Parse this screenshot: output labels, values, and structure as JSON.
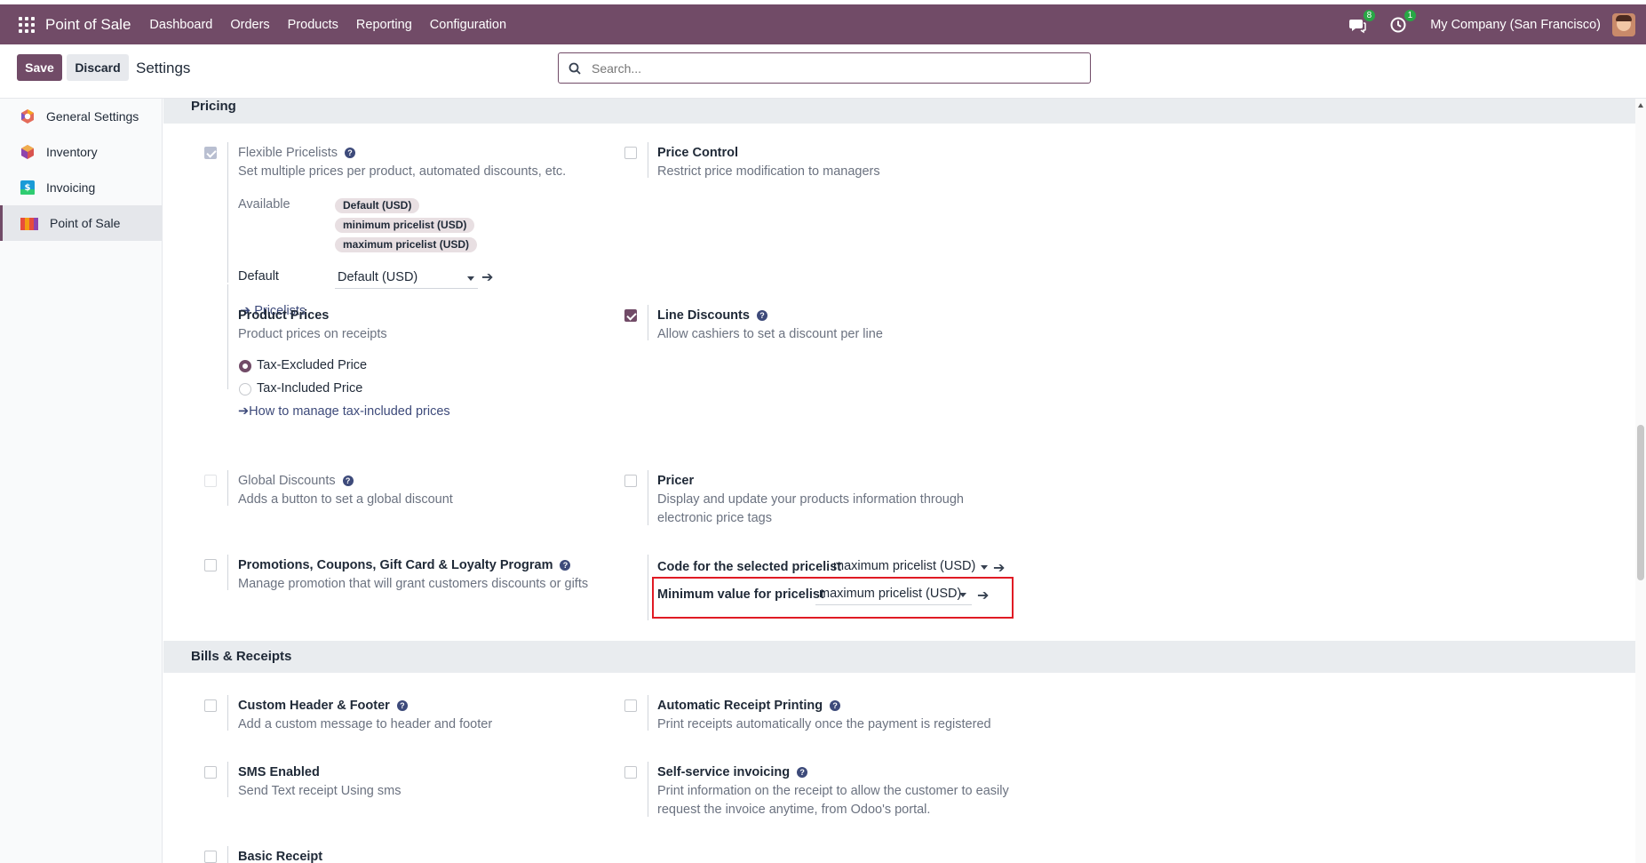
{
  "navbar": {
    "app_name": "Point of Sale",
    "menu": [
      "Dashboard",
      "Orders",
      "Products",
      "Reporting",
      "Configuration"
    ],
    "messages_count": "8",
    "activities_count": "1",
    "company": "My Company (San Francisco)"
  },
  "control_panel": {
    "save_label": "Save",
    "discard_label": "Discard",
    "title": "Settings",
    "search_placeholder": "Search..."
  },
  "sidebar": {
    "items": [
      {
        "label": "General Settings",
        "icon": "odoo-logo-icon"
      },
      {
        "label": "Inventory",
        "icon": "inventory-cube-icon"
      },
      {
        "label": "Invoicing",
        "icon": "invoice-dollar-icon"
      },
      {
        "label": "Point of Sale",
        "icon": "pos-store-icon"
      }
    ],
    "active": "Point of Sale"
  },
  "pricing": {
    "heading": "Pricing",
    "flexible_pricelists": {
      "title": "Flexible Pricelists",
      "desc": "Set multiple prices per product, automated discounts, etc.",
      "checked": true,
      "available_label": "Available",
      "available_tags": [
        "Default (USD)",
        "minimum pricelist (USD)",
        "maximum pricelist (USD)"
      ],
      "default_label": "Default",
      "default_value": "Default (USD)",
      "link": "Pricelists"
    },
    "price_control": {
      "title": "Price Control",
      "desc": "Restrict price modification to managers",
      "checked": false
    },
    "product_prices": {
      "title": "Product Prices",
      "desc": "Product prices on receipts",
      "options": [
        "Tax-Excluded Price",
        "Tax-Included Price"
      ],
      "selected": "Tax-Excluded Price",
      "link": "How to manage tax-included prices"
    },
    "line_discounts": {
      "title": "Line Discounts",
      "desc": "Allow cashiers to set a discount per line",
      "checked": true
    },
    "global_discounts": {
      "title": "Global Discounts",
      "desc": "Adds a button to set a global discount",
      "checked": false
    },
    "pricer": {
      "title": "Pricer",
      "desc_line1": "Display and update your products information through",
      "desc_line2": "electronic price tags",
      "checked": false
    },
    "promotions": {
      "title": "Promotions, Coupons, Gift Card & Loyalty Program",
      "desc": "Manage promotion that will grant customers discounts or gifts",
      "checked": false
    },
    "code_pricelist": {
      "label": "Code for the selected pricelist",
      "value": "maximum pricelist (USD)"
    },
    "min_value_pricelist": {
      "label": "Minimum value for pricelist",
      "value": "maximum pricelist (USD)"
    }
  },
  "bills": {
    "heading": "Bills & Receipts",
    "custom_header": {
      "title": "Custom Header & Footer",
      "desc": "Add a custom message to header and footer",
      "checked": false
    },
    "auto_print": {
      "title": "Automatic Receipt Printing",
      "desc": "Print receipts automatically once the payment is registered",
      "checked": false
    },
    "sms": {
      "title": "SMS Enabled",
      "desc": "Send Text receipt Using sms",
      "checked": false
    },
    "self_invoicing": {
      "title": "Self-service invoicing",
      "desc_line1": "Print information on the receipt to allow the customer to easily",
      "desc_line2": "request the invoice anytime, from Odoo's portal.",
      "checked": false
    },
    "basic_receipt": {
      "title": "Basic Receipt",
      "checked": false
    }
  },
  "colors": {
    "brand": "#714b67",
    "highlight": "#e01b24",
    "link": "#3d4a7a"
  }
}
